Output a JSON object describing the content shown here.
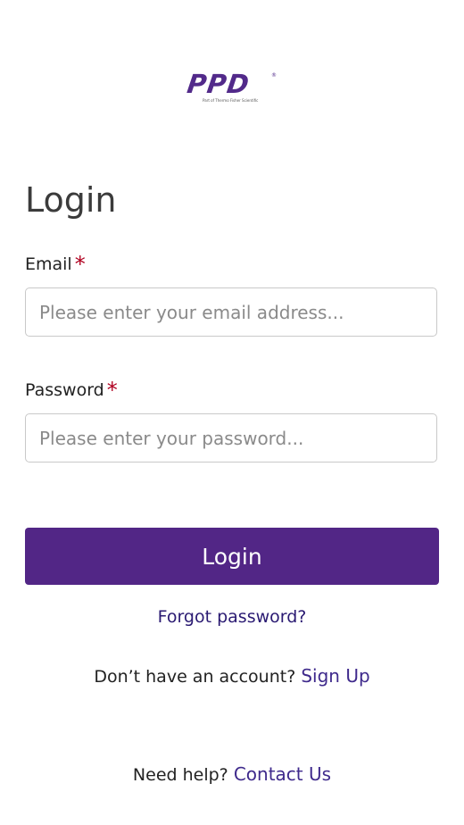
{
  "logo": {
    "text": "PPD",
    "registered": "®",
    "tagline": "Part of Thermo Fisher Scientific"
  },
  "page": {
    "title": "Login"
  },
  "form": {
    "email": {
      "label": "Email",
      "required_mark": "*",
      "placeholder": "Please enter your email address...",
      "value": ""
    },
    "password": {
      "label": "Password",
      "required_mark": "*",
      "placeholder": "Please enter your password...",
      "value": ""
    },
    "submit_label": "Login",
    "forgot_label": "Forgot password?"
  },
  "signup": {
    "prompt": "Don’t have an account?",
    "link_label": "Sign Up"
  },
  "help": {
    "prompt": "Need help?",
    "link_label": "Contact Us"
  },
  "colors": {
    "brand": "#522686",
    "link": "#3f2a8c",
    "required": "#b00020"
  }
}
